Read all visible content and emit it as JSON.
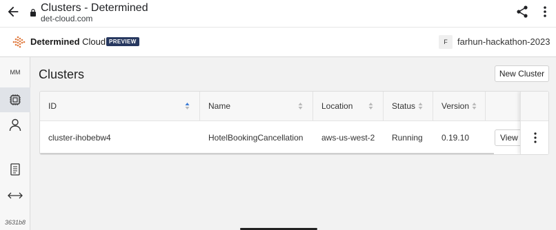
{
  "browser": {
    "title": "Clusters - Determined",
    "url": "det-cloud.com",
    "icons": [
      "back-arrow-icon",
      "lock-icon",
      "share-icon",
      "more-vert-icon"
    ]
  },
  "header": {
    "brand_bold": "Determined",
    "brand_light": " Cloud",
    "badge": "PREVIEW",
    "workspace_initial": "F",
    "workspace_name": "farhun-hackathon-2023"
  },
  "sidebar": {
    "avatar": "MM",
    "items": [
      {
        "icon": "chip-icon",
        "active": true
      },
      {
        "icon": "user-icon",
        "active": false
      },
      {
        "icon": "document-icon",
        "active": false
      },
      {
        "icon": "expand-horizontal-icon",
        "active": false
      }
    ],
    "version": "3631b8"
  },
  "main": {
    "title": "Clusters",
    "new_button": "New Cluster",
    "table": {
      "columns": [
        "ID",
        "Name",
        "Location",
        "Status",
        "Version"
      ],
      "rows": [
        {
          "id": "cluster-ihobebw4",
          "name": "HotelBookingCancellation",
          "location": "aws-us-west-2",
          "status": "Running",
          "version": "0.19.10",
          "action": "View Cluster"
        }
      ]
    }
  },
  "colors": {
    "badge_bg": "#27385f",
    "logo_orange": "#e07a3f",
    "sort_active": "#3a7bd5"
  }
}
